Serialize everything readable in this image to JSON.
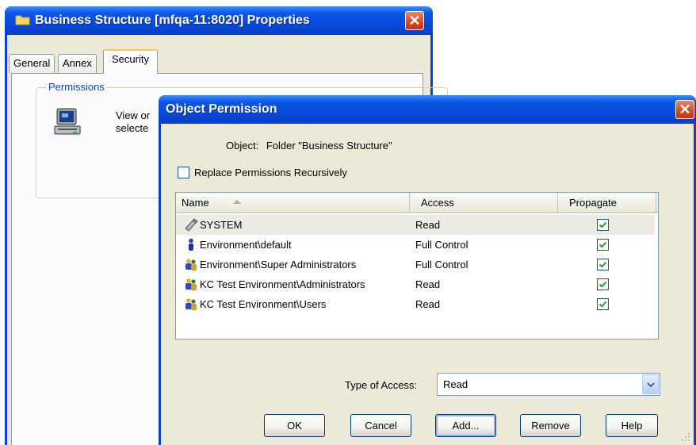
{
  "back_window": {
    "title": "Business Structure [mfqa-11:8020] Properties",
    "close_label": "✕",
    "tabs": [
      {
        "label": "General"
      },
      {
        "label": "Annex"
      },
      {
        "label": "Security"
      }
    ],
    "active_tab": "Security",
    "permissions_group": "Permissions",
    "description_line1": "View or",
    "description_line2": "selecte"
  },
  "dialog": {
    "title": "Object Permission",
    "close_label": "✕",
    "object_label": "Object:",
    "object_value": "Folder \"Business Structure\"",
    "replace_recursive_label": "Replace Permissions Recursively",
    "replace_recursive_checked": false,
    "columns": {
      "name": "Name",
      "access": "Access",
      "propagate": "Propagate"
    },
    "rows": [
      {
        "name": "SYSTEM",
        "access": "Read",
        "propagate": true,
        "icon": "system-icon"
      },
      {
        "name": "Environment\\default",
        "access": "Full Control",
        "propagate": true,
        "icon": "user-icon"
      },
      {
        "name": "Environment\\Super Administrators",
        "access": "Full Control",
        "propagate": true,
        "icon": "group-icon"
      },
      {
        "name": "KC Test Environment\\Administrators",
        "access": "Read",
        "propagate": true,
        "icon": "group-icon"
      },
      {
        "name": "KC Test Environment\\Users",
        "access": "Read",
        "propagate": true,
        "icon": "group-icon"
      }
    ],
    "type_of_access_label": "Type of Access:",
    "type_of_access_value": "Read",
    "buttons": {
      "ok": "OK",
      "cancel": "Cancel",
      "add": "Add...",
      "remove": "Remove",
      "help": "Help"
    }
  },
  "colors": {
    "title_bar": "#0747d6",
    "window_body": "#ece9d8",
    "group_label": "#0046d5",
    "check_mark": "#21a121"
  }
}
